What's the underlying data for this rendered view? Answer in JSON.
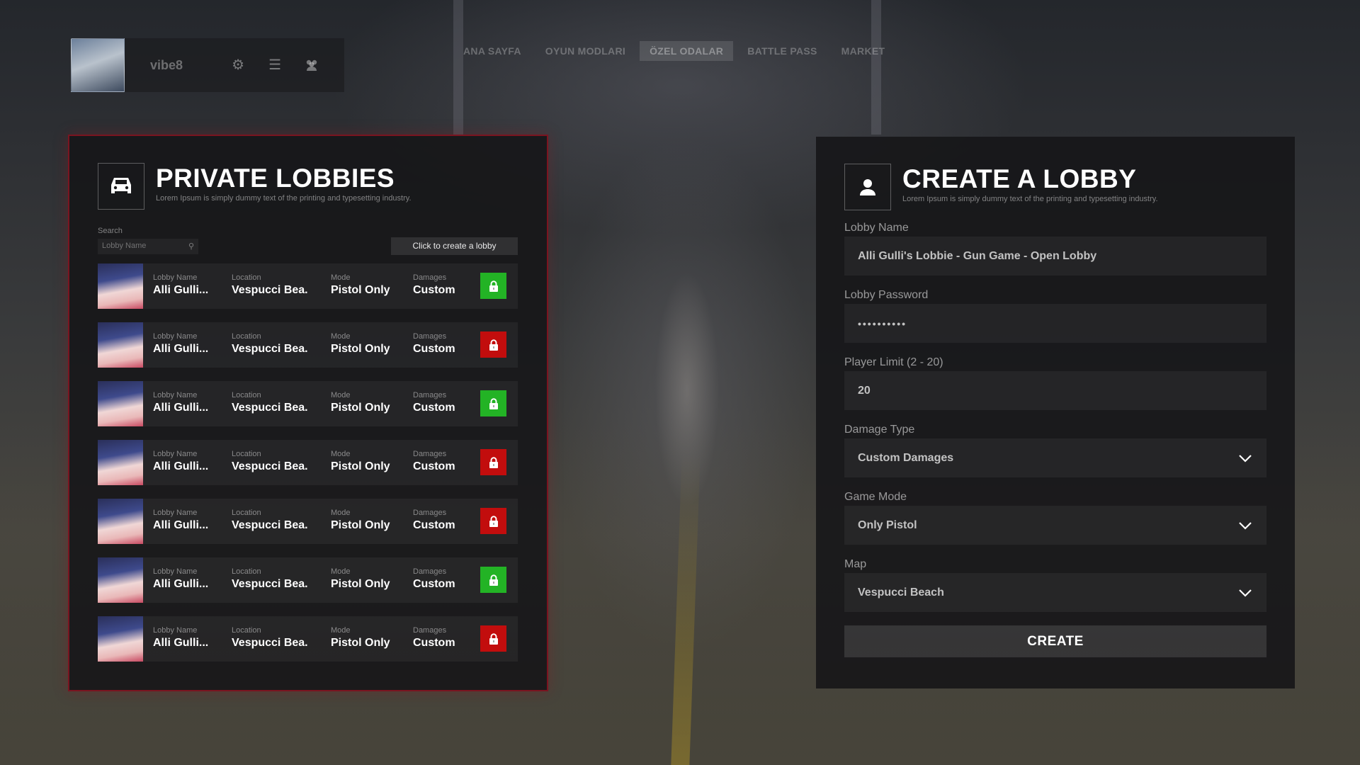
{
  "header": {
    "username": "vibe8",
    "brand": "",
    "nav": [
      {
        "label": "ANA SAYFA"
      },
      {
        "label": "OYUN MODLARI"
      },
      {
        "label": "ÖZEL ODALAR"
      },
      {
        "label": "BATTLE PASS"
      },
      {
        "label": "MARKET"
      }
    ],
    "active_nav": "ÖZEL ODALAR"
  },
  "private_lobbies": {
    "title": "PRIVATE LOBBIES",
    "subtitle": "Lorem Ipsum is simply dummy text of the printing and typesetting industry.",
    "search_label": "Search",
    "search_placeholder": "Lobby Name",
    "create_link": "Click to create a lobby",
    "column_labels": {
      "name": "Lobby Name",
      "location": "Location",
      "mode": "Mode",
      "damages": "Damages"
    },
    "rows": [
      {
        "name": "Alli Gulli...",
        "location": "Vespucci Bea.",
        "mode": "Pistol Only",
        "damages": "Custom",
        "lock": "open"
      },
      {
        "name": "Alli Gulli...",
        "location": "Vespucci Bea.",
        "mode": "Pistol Only",
        "damages": "Custom",
        "lock": "closed"
      },
      {
        "name": "Alli Gulli...",
        "location": "Vespucci Bea.",
        "mode": "Pistol Only",
        "damages": "Custom",
        "lock": "open"
      },
      {
        "name": "Alli Gulli...",
        "location": "Vespucci Bea.",
        "mode": "Pistol Only",
        "damages": "Custom",
        "lock": "closed"
      },
      {
        "name": "Alli Gulli...",
        "location": "Vespucci Bea.",
        "mode": "Pistol Only",
        "damages": "Custom",
        "lock": "closed"
      },
      {
        "name": "Alli Gulli...",
        "location": "Vespucci Bea.",
        "mode": "Pistol Only",
        "damages": "Custom",
        "lock": "open"
      },
      {
        "name": "Alli Gulli...",
        "location": "Vespucci Bea.",
        "mode": "Pistol Only",
        "damages": "Custom",
        "lock": "closed"
      }
    ]
  },
  "create_lobby": {
    "title": "CREATE A LOBBY",
    "subtitle": "Lorem Ipsum is simply dummy text of the printing and typesetting industry.",
    "fields": {
      "lobby_name": {
        "label": "Lobby Name",
        "value": "Alli Gulli's Lobbie - Gun Game - Open Lobby"
      },
      "lobby_password": {
        "label": "Lobby Password",
        "value": "••••••••••"
      },
      "player_limit": {
        "label": "Player Limit (2 - 20)",
        "value": "20"
      },
      "damage_type": {
        "label": "Damage Type",
        "value": "Custom Damages"
      },
      "game_mode": {
        "label": "Game Mode",
        "value": "Only Pistol"
      },
      "map": {
        "label": "Map",
        "value": "Vespucci Beach"
      }
    },
    "create_button": "CREATE"
  },
  "colors": {
    "lock_open": "#23b325",
    "lock_closed": "#c20d0d",
    "panel_border": "#7a1420"
  },
  "icons": {
    "settings": "gear-icon",
    "list": "list-icon",
    "friends": "users-icon",
    "private_lobbies": "car-icon",
    "create_lobby": "user-icon",
    "lock": "lock-icon",
    "dropdown": "chevron-down-icon"
  }
}
